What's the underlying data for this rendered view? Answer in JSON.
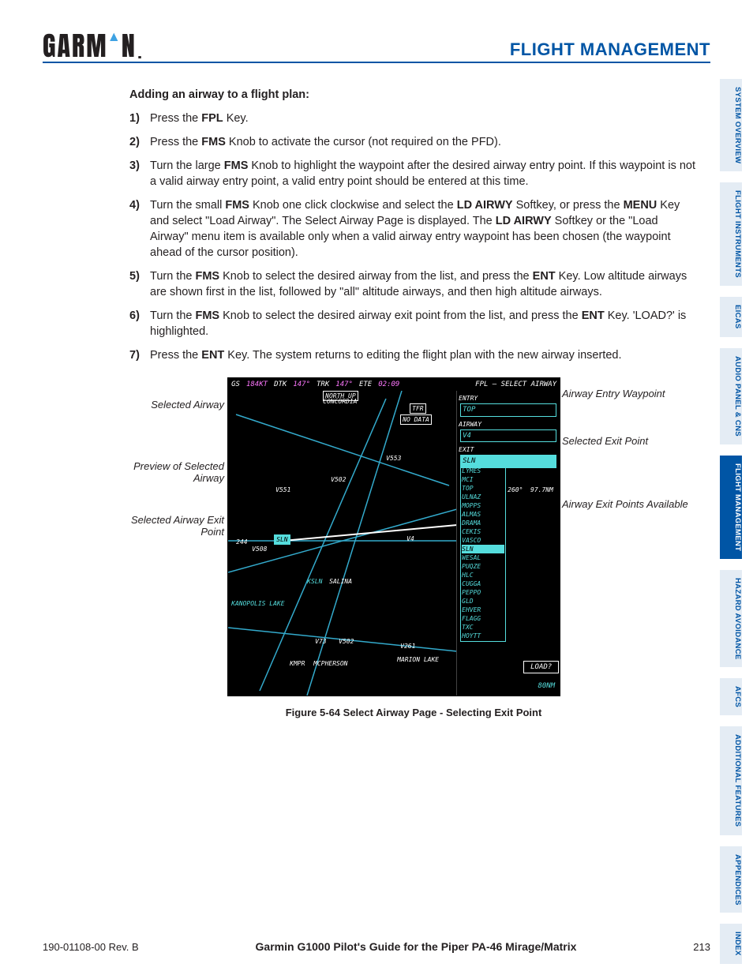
{
  "header": {
    "brand": "GARMIN",
    "section": "FLIGHT MANAGEMENT"
  },
  "subhead": "Adding an airway to a flight plan:",
  "steps": [
    {
      "n": "1)",
      "html": "Press the <b>FPL</b> Key."
    },
    {
      "n": "2)",
      "html": "Press the <b>FMS</b> Knob to activate the cursor (not required on the PFD)."
    },
    {
      "n": "3)",
      "html": "Turn the large <b>FMS</b> Knob to highlight the waypoint after the desired airway entry point.  If this waypoint is not a valid airway entry point, a valid entry point should be entered at this time."
    },
    {
      "n": "4)",
      "html": "Turn the small <b>FMS</b> Knob one click clockwise and select the <b>LD AIRWY</b> Softkey, or press the <b>MENU</b> Key and select \"Load Airway\". The Select Airway Page is displayed.  The <b>LD AIRWY</b> Softkey or the \"Load Airway\" menu item is available only when a valid airway entry waypoint has been chosen (the waypoint ahead of the cursor position)."
    },
    {
      "n": "5)",
      "html": "Turn the <b>FMS</b> Knob to select the desired airway from the list, and press the <b>ENT</b> Key.  Low altitude airways are shown first in the list, followed by \"all\" altitude airways, and then high altitude airways."
    },
    {
      "n": "6)",
      "html": "Turn the <b>FMS</b> Knob to select the desired airway exit point from the list, and press the <b>ENT</b> Key. 'LOAD?' is highlighted."
    },
    {
      "n": "7)",
      "html": "Press the <b>ENT</b> Key. The system returns to editing the flight plan with the new airway inserted."
    }
  ],
  "callouts": {
    "left": [
      "Selected Airway",
      "Preview of Selected Airway",
      "Selected Airway Exit Point"
    ],
    "right": [
      "Airway Entry Waypoint",
      "Selected Exit Point",
      "Airway Exit Points Available"
    ]
  },
  "screen": {
    "top": {
      "gs": "GS",
      "gs_val": "184KT",
      "dtk": "DTK",
      "dtk_val": "147°",
      "trk": "TRK",
      "trk_val": "147°",
      "ete": "ETE",
      "ete_val": "02:09",
      "title": "FPL – SELECT AIRWAY"
    },
    "north": "NORTH UP",
    "tfr": "TFR",
    "nodata": "NO DATA",
    "entry_lbl": "ENTRY",
    "entry": "TOP",
    "airway_lbl": "AIRWAY",
    "airway": "V4",
    "exit_lbl": "EXIT",
    "exit": "SLN",
    "brg": "260°",
    "dist": "97.7NM",
    "exit_points": [
      "LYMES",
      "MCI",
      "TOP",
      "ULNAZ",
      "MOPPS",
      "ALMAS",
      "DRAMA",
      "CEKIS",
      "VASCO",
      "SLN",
      "WESAL",
      "PUQZE",
      "HLC",
      "CUGGA",
      "PEPPO",
      "GLD",
      "EHVER",
      "FLAGG",
      "TXC",
      "HOYTT"
    ],
    "load": "LOAD?",
    "range": "80NM",
    "map_labels": {
      "concordia": "CONCORDIA",
      "ksln": "KSLN",
      "salina": "SALINA",
      "kmpr": "KMPR",
      "kanopolis": "KANOPOLIS LAKE",
      "mcpherson": "MCPHERSON",
      "marion": "MARION LAKE",
      "sln_box": "SLN"
    },
    "map_wps": [
      "V551",
      "V502",
      "V553",
      "V4",
      "V73",
      "V502",
      "V508",
      "V261",
      "244"
    ]
  },
  "caption": "Figure 5-64  Select Airway Page - Selecting Exit Point",
  "tabs": [
    "SYSTEM OVERVIEW",
    "FLIGHT INSTRUMENTS",
    "EICAS",
    "AUDIO PANEL & CNS",
    "FLIGHT MANAGEMENT",
    "HAZARD AVOIDANCE",
    "AFCS",
    "ADDITIONAL FEATURES",
    "APPENDICES",
    "INDEX"
  ],
  "active_tab": 4,
  "footer": {
    "left": "190-01108-00  Rev. B",
    "mid": "Garmin G1000 Pilot's Guide for the Piper PA-46 Mirage/Matrix",
    "right": "213"
  }
}
